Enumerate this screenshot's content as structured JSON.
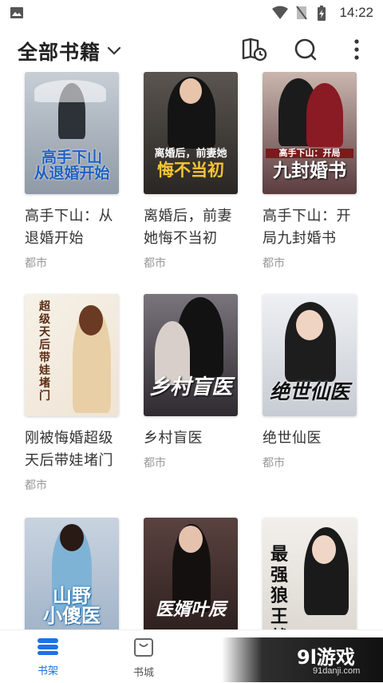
{
  "status": {
    "time": "14:22"
  },
  "header": {
    "title": "全部书籍"
  },
  "books": [
    {
      "title": "高手下山：从退婚开始",
      "category": "都市",
      "cover_text": "高手下山\n从退婚开始",
      "cover_bg": "#9aa6b2",
      "accent": "#1f5fbf"
    },
    {
      "title": "离婚后，前妻她悔不当初",
      "category": "都市",
      "cover_text": "离婚后，前妻她\n悔不当初",
      "cover_bg": "#3a3a3a",
      "accent": "#f5c531"
    },
    {
      "title": "高手下山：开局九封婚书",
      "category": "都市",
      "cover_text": "高手下山：开局\n九封婚书",
      "cover_bg": "#6e4a4e",
      "accent": "#ffffff"
    },
    {
      "title": "刚被悔婚超级天后带娃堵门",
      "category": "都市",
      "cover_text": "超级天后带娃堵门",
      "cover_bg": "#f1ece3",
      "accent": "#6a3a1a"
    },
    {
      "title": "乡村盲医",
      "category": "都市",
      "cover_text": "乡村盲医",
      "cover_bg": "#4f4b52",
      "accent": "#ffffff"
    },
    {
      "title": "绝世仙医",
      "category": "都市",
      "cover_text": "绝世仙医",
      "cover_bg": "#d9dde3",
      "accent": "#1a1a1a"
    },
    {
      "title": "",
      "category": "",
      "cover_text": "山野\n小傻医",
      "cover_bg": "#bcc7d6",
      "accent": "#2a8ad4"
    },
    {
      "title": "",
      "category": "",
      "cover_text": "医婿叶辰",
      "cover_bg": "#3b2b2a",
      "accent": "#ffffff"
    },
    {
      "title": "",
      "category": "",
      "cover_text": "最强\n狼王战兵",
      "cover_bg": "#e9e6e2",
      "accent": "#1a1a1a"
    }
  ],
  "nav": {
    "items": [
      {
        "label": "书架",
        "active": true
      },
      {
        "label": "书城",
        "active": false
      }
    ],
    "active_color": "#1a73e8",
    "inactive_color": "#555555"
  },
  "watermark": {
    "logo": "9l游戏",
    "url": "91danji.com"
  }
}
